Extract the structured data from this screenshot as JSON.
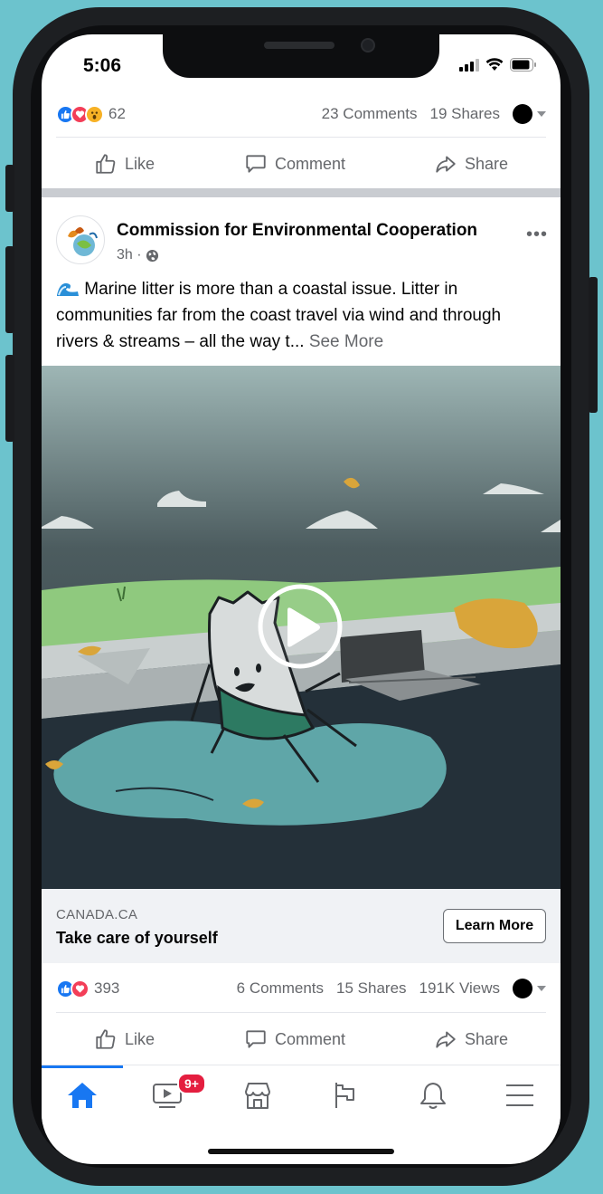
{
  "status_bar": {
    "time": "5:06"
  },
  "prev_post": {
    "reaction_count": "62",
    "comments": "23 Comments",
    "shares": "19 Shares"
  },
  "actions": {
    "like": "Like",
    "comment": "Comment",
    "share": "Share"
  },
  "post": {
    "page_name": "Commission for Environmental Cooperation",
    "time": "3h ·",
    "text": "Marine litter is more than a coastal issue. Litter in communities far from the coast travel via wind and through rivers & streams – all the way t...",
    "see_more": "See More",
    "link": {
      "domain": "CANADA.CA",
      "title": "Take care of yourself",
      "cta": "Learn More"
    },
    "reaction_count": "393",
    "comments": "6 Comments",
    "shares": "15 Shares",
    "views": "191K Views"
  },
  "nav": {
    "items": [
      {
        "icon": "home-icon",
        "active": true
      },
      {
        "icon": "watch-icon",
        "badge": "9+"
      },
      {
        "icon": "marketplace-icon"
      },
      {
        "icon": "pages-flag-icon"
      },
      {
        "icon": "bell-icon"
      },
      {
        "icon": "menu-icon"
      }
    ]
  },
  "colors": {
    "accent": "#1877f2",
    "badge": "#e41e3f",
    "background": "#6cc3cd"
  }
}
